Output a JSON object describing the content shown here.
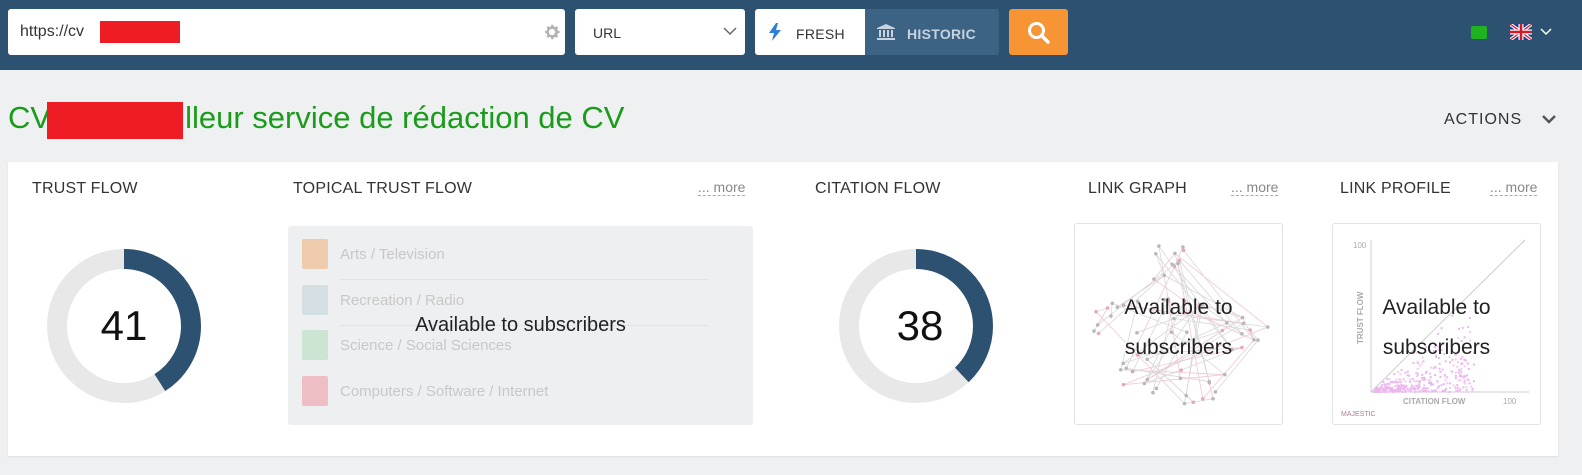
{
  "search": {
    "url_value": "https://cv",
    "mode_select": "URL",
    "fresh_label": "FRESH",
    "historic_label": "HISTORIC"
  },
  "colors": {
    "topbar": "#2d5170",
    "accent_orange": "#f79433",
    "title_green": "#1a9c1a",
    "donut_fill": "#2d5170",
    "donut_track": "#e8e8e8",
    "status_green": "#1fb31f"
  },
  "header": {
    "title": "CV",
    "title_rest": "lleur service de rédaction de CV",
    "actions_label": "ACTIONS"
  },
  "trust_flow": {
    "title": "TRUST FLOW",
    "value": "41"
  },
  "topical_trust_flow": {
    "title": "TOPICAL TRUST FLOW",
    "more": "... more",
    "overlay": "Available to subscribers",
    "topics": [
      {
        "name": "Arts / Television",
        "color": "#f0a86a"
      },
      {
        "name": "Recreation / Radio",
        "color": "#b7cfd6"
      },
      {
        "name": "Science / Social Sciences",
        "color": "#a8dcb4"
      },
      {
        "name": "Computers / Software / Internet",
        "color": "#ee8e98"
      }
    ]
  },
  "citation_flow": {
    "title": "CITATION FLOW",
    "value": "38"
  },
  "link_graph": {
    "title": "LINK GRAPH",
    "more": "... more",
    "overlay_line1": "Available to",
    "overlay_line2": "subscribers"
  },
  "link_profile": {
    "title": "LINK PROFILE",
    "more": "... more",
    "overlay_line1": "Available to",
    "overlay_line2": "subscribers",
    "y_axis_label": "TRUST FLOW",
    "x_axis_label": "CITATION FLOW",
    "y_max_label": "100",
    "x_max_label": "100",
    "brand": "MAJESTIC"
  },
  "icons": {
    "gear": "gear-icon",
    "chevron": "chevron-down-icon",
    "fresh": "lightning-icon",
    "historic": "bank-icon",
    "search": "search-icon",
    "flag": "uk-flag-icon"
  }
}
